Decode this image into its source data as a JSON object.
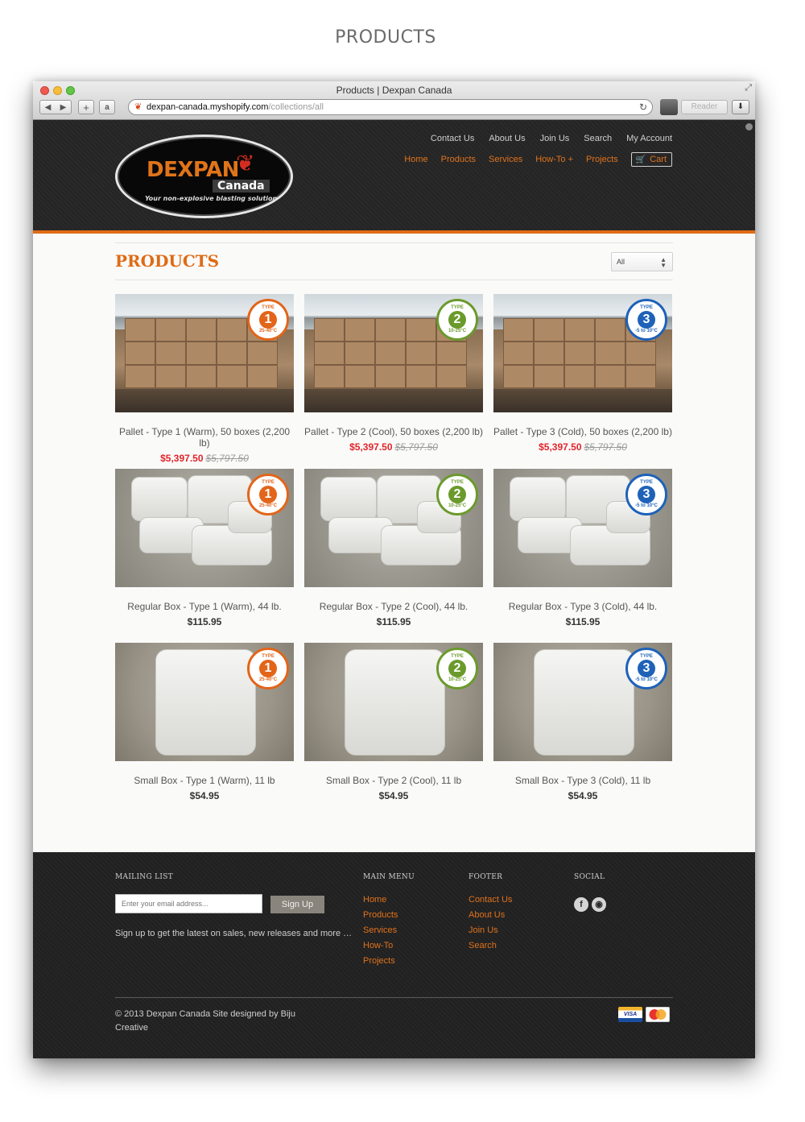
{
  "caption": "PRODUCTS",
  "browser": {
    "title": "Products | Dexpan Canada",
    "url_host": "dexpan-canada.myshopify.com",
    "url_path": "/collections/all",
    "reader_label": "Reader"
  },
  "logo": {
    "brand": "DEXPAN",
    "sub": "Canada",
    "tagline": "Your non-explosive blasting solution"
  },
  "util_nav": [
    "Contact Us",
    "About Us",
    "Join Us",
    "Search",
    "My Account"
  ],
  "main_nav": [
    "Home",
    "Products",
    "Services",
    "How-To",
    "Projects"
  ],
  "main_nav_dropdown_marker": "+",
  "cart_label": "Cart",
  "page": {
    "title": "PRODUCTS",
    "filter_value": "All"
  },
  "products": [
    {
      "name": "Pallet - Type 1 (Warm), 50 boxes (2,200 lb)",
      "price": "$5,397.50",
      "old_price": "$5,797.50",
      "type": "1",
      "range": "25-40°C",
      "color": "#e2651a",
      "image": "pallet"
    },
    {
      "name": "Pallet - Type 2 (Cool), 50 boxes (2,200 lb)",
      "price": "$5,397.50",
      "old_price": "$5,797.50",
      "type": "2",
      "range": "10-25°C",
      "color": "#6b9a2c",
      "image": "pallet"
    },
    {
      "name": "Pallet - Type 3 (Cold), 50 boxes (2,200 lb)",
      "price": "$5,397.50",
      "old_price": "$5,797.50",
      "type": "3",
      "range": "-5 to 10°C",
      "color": "#1e62b8",
      "image": "pallet"
    },
    {
      "name": "Regular Box - Type 1 (Warm), 44 lb.",
      "price": "$115.95",
      "old_price": "",
      "type": "1",
      "range": "25-40°C",
      "color": "#e2651a",
      "image": "bags"
    },
    {
      "name": "Regular Box - Type 2 (Cool), 44 lb.",
      "price": "$115.95",
      "old_price": "",
      "type": "2",
      "range": "10-25°C",
      "color": "#6b9a2c",
      "image": "bags"
    },
    {
      "name": "Regular Box - Type 3 (Cold), 44 lb.",
      "price": "$115.95",
      "old_price": "",
      "type": "3",
      "range": "-5 to 10°C",
      "color": "#1e62b8",
      "image": "bags"
    },
    {
      "name": "Small Box - Type 1 (Warm), 11 lb",
      "price": "$54.95",
      "old_price": "",
      "type": "1",
      "range": "25-40°C",
      "color": "#e2651a",
      "image": "small"
    },
    {
      "name": "Small Box - Type 2 (Cool), 11 lb",
      "price": "$54.95",
      "old_price": "",
      "type": "2",
      "range": "10-25°C",
      "color": "#6b9a2c",
      "image": "small"
    },
    {
      "name": "Small Box - Type 3 (Cold), 11 lb",
      "price": "$54.95",
      "old_price": "",
      "type": "3",
      "range": "-5 to 10°C",
      "color": "#1e62b8",
      "image": "small"
    }
  ],
  "badge_type_label": "TYPE",
  "footer": {
    "mailing_heading": "MAILING LIST",
    "email_placeholder": "Enter your email address...",
    "signup_label": "Sign Up",
    "signup_note": "Sign up to get the latest on sales, new releases and more …",
    "main_menu_heading": "MAIN MENU",
    "main_menu": [
      "Home",
      "Products",
      "Services",
      "How-To",
      "Projects"
    ],
    "footer_heading": "FOOTER",
    "footer_links": [
      "Contact Us",
      "About Us",
      "Join Us",
      "Search"
    ],
    "social_heading": "SOCIAL",
    "copyright": "© 2013 Dexpan Canada Site designed by Biju Creative",
    "card_visa": "VISA",
    "card_mc": "MasterCard"
  },
  "colors": {
    "accent": "#e0721c",
    "sale": "#e2242a"
  }
}
